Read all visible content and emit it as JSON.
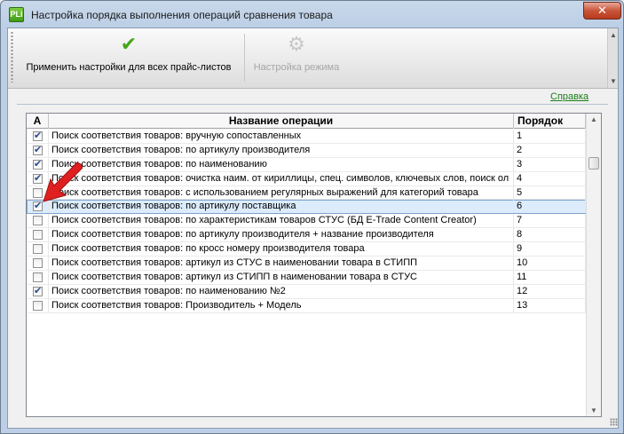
{
  "window": {
    "title": "Настройка порядка выполнения операций сравнения товара",
    "app_icon_text": "PLi",
    "close_glyph": "✕"
  },
  "toolbar": {
    "apply_label": "Применить настройки для всех прайс-листов",
    "apply_icon": "check-icon",
    "mode_label": "Настройка режима",
    "mode_icon": "gear-icon"
  },
  "help": {
    "label": "Справка"
  },
  "grid": {
    "columns": {
      "a": "A",
      "name": "Название операции",
      "order": "Порядок"
    },
    "rows": [
      {
        "checked": true,
        "name": "Поиск соответствия товаров: вручную сопоставленных",
        "order": "1"
      },
      {
        "checked": true,
        "name": "Поиск соответствия товаров: по артикулу производителя",
        "order": "2"
      },
      {
        "checked": true,
        "name": "Поиск соответствия товаров: по наименованию",
        "order": "3"
      },
      {
        "checked": true,
        "name": "Поиск соответствия товаров: очистка наим. от кириллицы, спец. символов, ключевых слов, поиск ол",
        "order": "4"
      },
      {
        "checked": false,
        "name": "Поиск соответствия товаров: с использованием регулярных выражений для категорий товара",
        "order": "5"
      },
      {
        "checked": true,
        "name": "Поиск соответствия товаров: по артикулу поставщика",
        "order": "6",
        "selected": true
      },
      {
        "checked": false,
        "name": "Поиск соответствия товаров: по характеристикам товаров СТУС (БД E-Trade Content Creator)",
        "order": "7"
      },
      {
        "checked": false,
        "name": "Поиск соответствия товаров: по артикулу производителя + название производителя",
        "order": "8"
      },
      {
        "checked": false,
        "name": "Поиск соответствия товаров: по кросс номеру производителя товара",
        "order": "9"
      },
      {
        "checked": false,
        "name": "Поиск соответствия товаров: артикул из СТУС в наименовании товара в СТИПП",
        "order": "10"
      },
      {
        "checked": false,
        "name": "Поиск соответствия товаров: артикул из СТИПП в наименовании товара в СТУС",
        "order": "11"
      },
      {
        "checked": true,
        "name": "Поиск соответствия товаров: по наименованию №2",
        "order": "12"
      },
      {
        "checked": false,
        "name": "Поиск соответствия товаров: Производитель + Модель",
        "order": "13"
      }
    ]
  },
  "annotation": {
    "arrow_color": "#e02020"
  }
}
